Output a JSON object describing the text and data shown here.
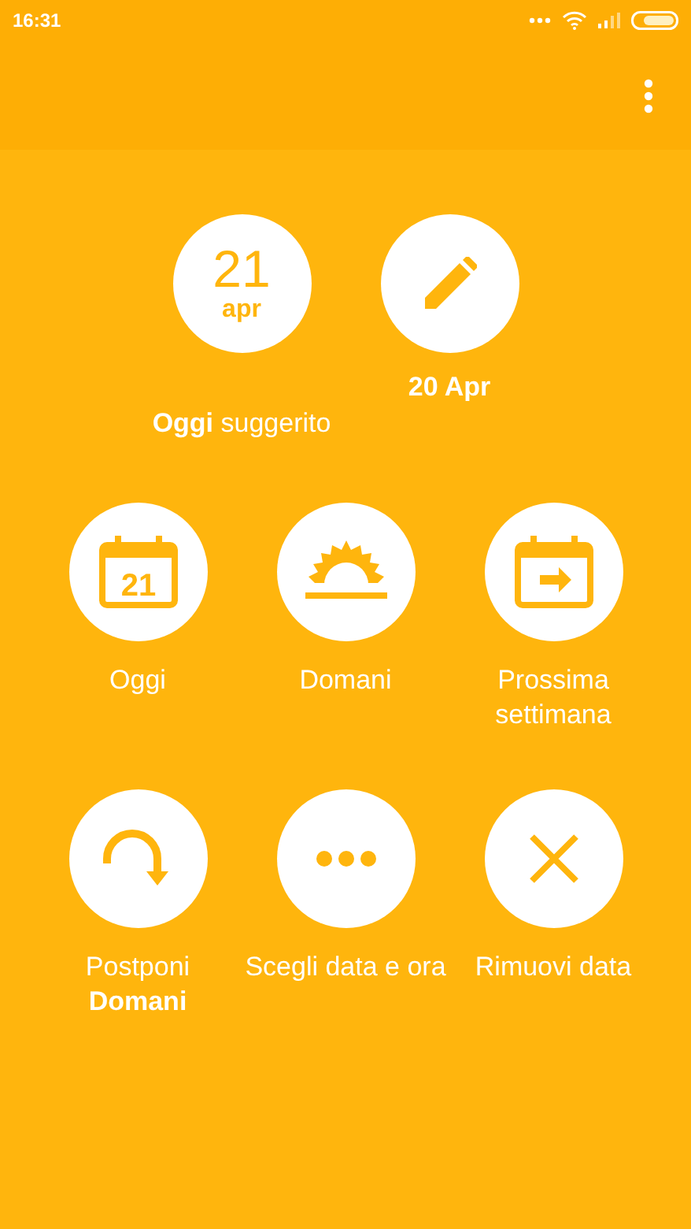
{
  "status_bar": {
    "time": "16:31"
  },
  "suggestions": [
    {
      "kind": "date",
      "day": "21",
      "month": "apr",
      "label": "**Oggi** suggerito"
    },
    {
      "kind": "edit",
      "label": "20 Apr"
    }
  ],
  "options": [
    {
      "kind": "calendar-day",
      "day": "21",
      "label": "Oggi"
    },
    {
      "kind": "sunrise",
      "label": "Domani"
    },
    {
      "kind": "calendar-arrow",
      "label": "Prossima settimana"
    },
    {
      "kind": "postpone",
      "label": "Postponi **Domani**"
    },
    {
      "kind": "dots",
      "label": "Scegli data e ora"
    },
    {
      "kind": "close",
      "label": "Rimuovi data"
    }
  ]
}
